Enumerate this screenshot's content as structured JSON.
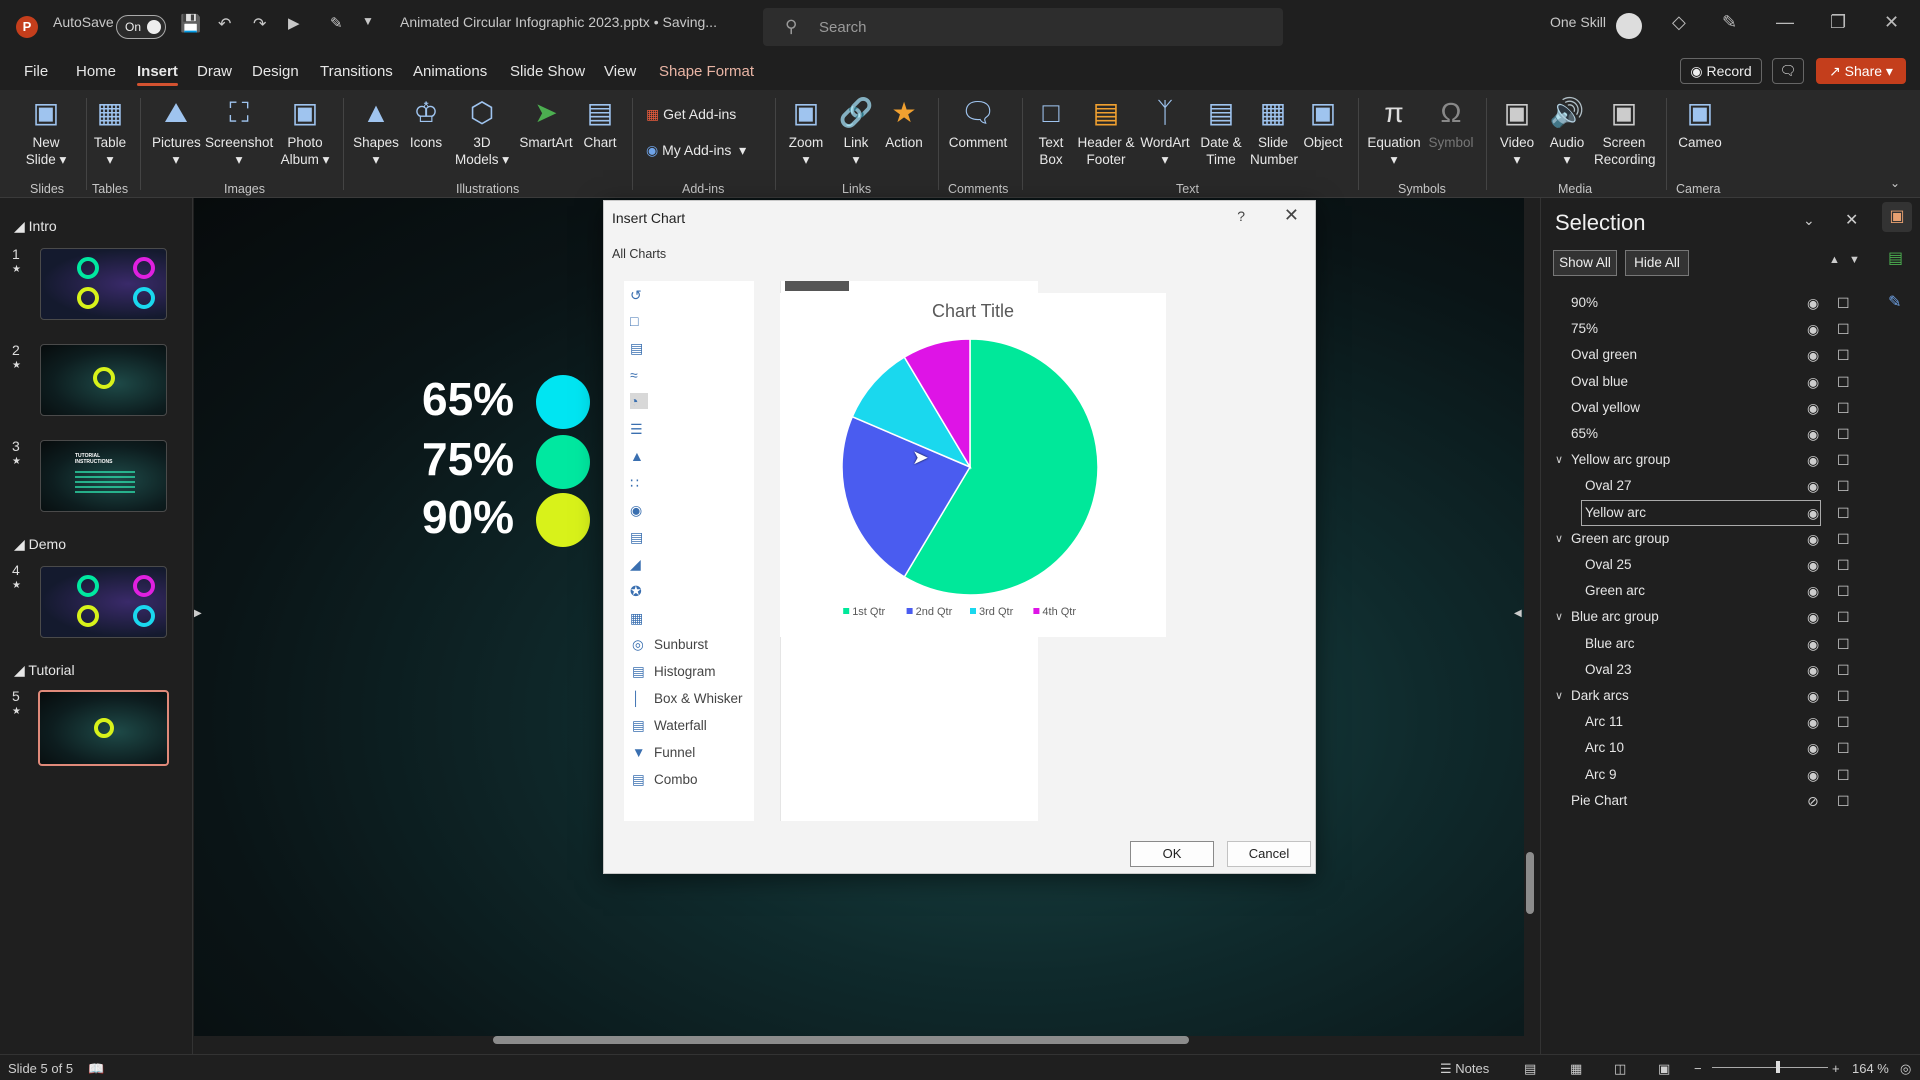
{
  "titlebar": {
    "autosave_label": "AutoSave",
    "autosave_state": "On",
    "filename": "Animated Circular Infographic 2023.pptx • Saving...",
    "search_placeholder": "Search",
    "user_name": "One Skill"
  },
  "menu": {
    "tabs": [
      "File",
      "Home",
      "Insert",
      "Draw",
      "Design",
      "Transitions",
      "Animations",
      "Slide Show",
      "View",
      "Shape Format"
    ],
    "active": "Insert",
    "record_label": "Record",
    "share_label": "Share"
  },
  "ribbon": {
    "new_slide": "New Slide",
    "table": "Table",
    "pictures": "Pictures",
    "screenshot": "Screenshot",
    "photo_album": "Photo Album",
    "shapes": "Shapes",
    "icons": "Icons",
    "models_3d": "3D Models",
    "smartart": "SmartArt",
    "chart": "Chart",
    "get_addins": "Get Add-ins",
    "my_addins": "My Add-ins",
    "zoom": "Zoom",
    "link": "Link",
    "action": "Action",
    "comment": "Comment",
    "text_box": "Text Box",
    "header_footer": "Header & Footer",
    "wordart": "WordArt",
    "date_time": "Date & Time",
    "slide_number": "Slide Number",
    "object": "Object",
    "equation": "Equation",
    "symbol": "Symbol",
    "video": "Video",
    "audio": "Audio",
    "screen_recording": "Screen Recording",
    "cameo": "Cameo",
    "groups": {
      "slides": "Slides",
      "tables": "Tables",
      "images": "Images",
      "illustrations": "Illustrations",
      "addins": "Add-ins",
      "links": "Links",
      "comments": "Comments",
      "text": "Text",
      "symbols": "Symbols",
      "media": "Media",
      "camera": "Camera"
    }
  },
  "thumbnails": {
    "sections": [
      "Intro",
      "Demo",
      "Tutorial"
    ],
    "slides": [
      "1",
      "2",
      "3",
      "4",
      "5"
    ],
    "selected_slide": "5",
    "slide3_text": "TUTORIAL INSTRUCTIONS"
  },
  "slide": {
    "rows": [
      {
        "label": "65%",
        "color": "#00e5f2"
      },
      {
        "label": "75%",
        "color": "#00e8a0"
      },
      {
        "label": "90%",
        "color": "#d8f21a"
      }
    ]
  },
  "dialog": {
    "title": "Insert Chart",
    "help": "?",
    "tab": "All Charts",
    "chart_types": [
      "Sunburst",
      "Histogram",
      "Box & Whisker",
      "Waterfall",
      "Funnel",
      "Combo"
    ],
    "ok_label": "OK",
    "cancel_label": "Cancel"
  },
  "chart_data": {
    "type": "pie",
    "title": "Chart Title",
    "categories": [
      "1st Qtr",
      "2nd Qtr",
      "3rd Qtr",
      "4th Qtr"
    ],
    "values": [
      8.2,
      3.2,
      1.4,
      1.2
    ],
    "colors": [
      "#00e89a",
      "#4a5cf0",
      "#1ad8ee",
      "#de14e6"
    ],
    "legend": "bottom"
  },
  "selection_pane": {
    "title": "Selection",
    "show_all": "Show All",
    "hide_all": "Hide All",
    "items": [
      {
        "label": "90%",
        "level": 0
      },
      {
        "label": "75%",
        "level": 0
      },
      {
        "label": "Oval green",
        "level": 0
      },
      {
        "label": "Oval blue",
        "level": 0
      },
      {
        "label": "Oval yellow",
        "level": 0
      },
      {
        "label": "65%",
        "level": 0
      },
      {
        "label": "Yellow arc group",
        "level": 0,
        "group": true
      },
      {
        "label": "Oval 27",
        "level": 1
      },
      {
        "label": "Yellow arc",
        "level": 1,
        "selected": true
      },
      {
        "label": "Green arc group",
        "level": 0,
        "group": true
      },
      {
        "label": "Oval 25",
        "level": 1
      },
      {
        "label": "Green arc",
        "level": 1
      },
      {
        "label": "Blue arc group",
        "level": 0,
        "group": true
      },
      {
        "label": "Blue arc",
        "level": 1
      },
      {
        "label": "Oval 23",
        "level": 1
      },
      {
        "label": "Dark arcs",
        "level": 0,
        "group": true
      },
      {
        "label": "Arc 11",
        "level": 1
      },
      {
        "label": "Arc 10",
        "level": 1
      },
      {
        "label": "Arc 9",
        "level": 1
      },
      {
        "label": "Pie Chart",
        "level": 0,
        "hidden": true
      }
    ]
  },
  "statusbar": {
    "slide_info": "Slide 5 of 5",
    "notes": "Notes",
    "zoom": "164 %"
  },
  "icons": {
    "eye": "eye-icon",
    "lock": "lock-icon"
  }
}
